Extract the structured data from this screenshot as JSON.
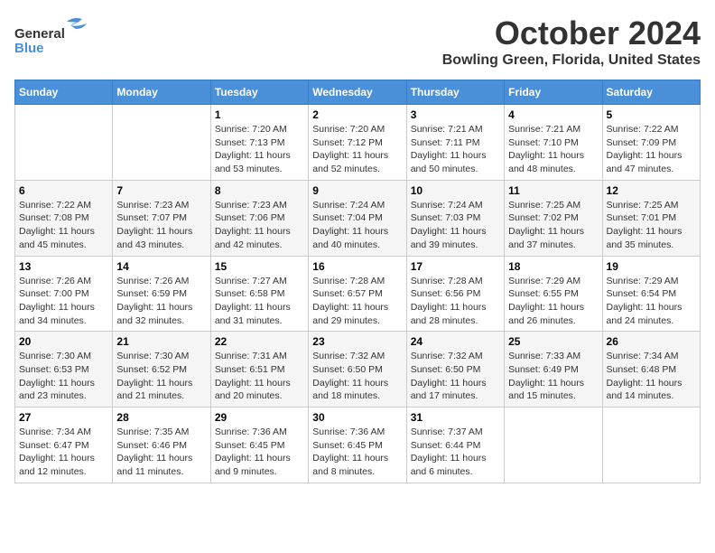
{
  "logo": {
    "text1": "General",
    "text2": "Blue"
  },
  "title": "October 2024",
  "location": "Bowling Green, Florida, United States",
  "weekdays": [
    "Sunday",
    "Monday",
    "Tuesday",
    "Wednesday",
    "Thursday",
    "Friday",
    "Saturday"
  ],
  "weeks": [
    [
      {
        "day": "",
        "sunrise": "",
        "sunset": "",
        "daylight": ""
      },
      {
        "day": "",
        "sunrise": "",
        "sunset": "",
        "daylight": ""
      },
      {
        "day": "1",
        "sunrise": "Sunrise: 7:20 AM",
        "sunset": "Sunset: 7:13 PM",
        "daylight": "Daylight: 11 hours and 53 minutes."
      },
      {
        "day": "2",
        "sunrise": "Sunrise: 7:20 AM",
        "sunset": "Sunset: 7:12 PM",
        "daylight": "Daylight: 11 hours and 52 minutes."
      },
      {
        "day": "3",
        "sunrise": "Sunrise: 7:21 AM",
        "sunset": "Sunset: 7:11 PM",
        "daylight": "Daylight: 11 hours and 50 minutes."
      },
      {
        "day": "4",
        "sunrise": "Sunrise: 7:21 AM",
        "sunset": "Sunset: 7:10 PM",
        "daylight": "Daylight: 11 hours and 48 minutes."
      },
      {
        "day": "5",
        "sunrise": "Sunrise: 7:22 AM",
        "sunset": "Sunset: 7:09 PM",
        "daylight": "Daylight: 11 hours and 47 minutes."
      }
    ],
    [
      {
        "day": "6",
        "sunrise": "Sunrise: 7:22 AM",
        "sunset": "Sunset: 7:08 PM",
        "daylight": "Daylight: 11 hours and 45 minutes."
      },
      {
        "day": "7",
        "sunrise": "Sunrise: 7:23 AM",
        "sunset": "Sunset: 7:07 PM",
        "daylight": "Daylight: 11 hours and 43 minutes."
      },
      {
        "day": "8",
        "sunrise": "Sunrise: 7:23 AM",
        "sunset": "Sunset: 7:06 PM",
        "daylight": "Daylight: 11 hours and 42 minutes."
      },
      {
        "day": "9",
        "sunrise": "Sunrise: 7:24 AM",
        "sunset": "Sunset: 7:04 PM",
        "daylight": "Daylight: 11 hours and 40 minutes."
      },
      {
        "day": "10",
        "sunrise": "Sunrise: 7:24 AM",
        "sunset": "Sunset: 7:03 PM",
        "daylight": "Daylight: 11 hours and 39 minutes."
      },
      {
        "day": "11",
        "sunrise": "Sunrise: 7:25 AM",
        "sunset": "Sunset: 7:02 PM",
        "daylight": "Daylight: 11 hours and 37 minutes."
      },
      {
        "day": "12",
        "sunrise": "Sunrise: 7:25 AM",
        "sunset": "Sunset: 7:01 PM",
        "daylight": "Daylight: 11 hours and 35 minutes."
      }
    ],
    [
      {
        "day": "13",
        "sunrise": "Sunrise: 7:26 AM",
        "sunset": "Sunset: 7:00 PM",
        "daylight": "Daylight: 11 hours and 34 minutes."
      },
      {
        "day": "14",
        "sunrise": "Sunrise: 7:26 AM",
        "sunset": "Sunset: 6:59 PM",
        "daylight": "Daylight: 11 hours and 32 minutes."
      },
      {
        "day": "15",
        "sunrise": "Sunrise: 7:27 AM",
        "sunset": "Sunset: 6:58 PM",
        "daylight": "Daylight: 11 hours and 31 minutes."
      },
      {
        "day": "16",
        "sunrise": "Sunrise: 7:28 AM",
        "sunset": "Sunset: 6:57 PM",
        "daylight": "Daylight: 11 hours and 29 minutes."
      },
      {
        "day": "17",
        "sunrise": "Sunrise: 7:28 AM",
        "sunset": "Sunset: 6:56 PM",
        "daylight": "Daylight: 11 hours and 28 minutes."
      },
      {
        "day": "18",
        "sunrise": "Sunrise: 7:29 AM",
        "sunset": "Sunset: 6:55 PM",
        "daylight": "Daylight: 11 hours and 26 minutes."
      },
      {
        "day": "19",
        "sunrise": "Sunrise: 7:29 AM",
        "sunset": "Sunset: 6:54 PM",
        "daylight": "Daylight: 11 hours and 24 minutes."
      }
    ],
    [
      {
        "day": "20",
        "sunrise": "Sunrise: 7:30 AM",
        "sunset": "Sunset: 6:53 PM",
        "daylight": "Daylight: 11 hours and 23 minutes."
      },
      {
        "day": "21",
        "sunrise": "Sunrise: 7:30 AM",
        "sunset": "Sunset: 6:52 PM",
        "daylight": "Daylight: 11 hours and 21 minutes."
      },
      {
        "day": "22",
        "sunrise": "Sunrise: 7:31 AM",
        "sunset": "Sunset: 6:51 PM",
        "daylight": "Daylight: 11 hours and 20 minutes."
      },
      {
        "day": "23",
        "sunrise": "Sunrise: 7:32 AM",
        "sunset": "Sunset: 6:50 PM",
        "daylight": "Daylight: 11 hours and 18 minutes."
      },
      {
        "day": "24",
        "sunrise": "Sunrise: 7:32 AM",
        "sunset": "Sunset: 6:50 PM",
        "daylight": "Daylight: 11 hours and 17 minutes."
      },
      {
        "day": "25",
        "sunrise": "Sunrise: 7:33 AM",
        "sunset": "Sunset: 6:49 PM",
        "daylight": "Daylight: 11 hours and 15 minutes."
      },
      {
        "day": "26",
        "sunrise": "Sunrise: 7:34 AM",
        "sunset": "Sunset: 6:48 PM",
        "daylight": "Daylight: 11 hours and 14 minutes."
      }
    ],
    [
      {
        "day": "27",
        "sunrise": "Sunrise: 7:34 AM",
        "sunset": "Sunset: 6:47 PM",
        "daylight": "Daylight: 11 hours and 12 minutes."
      },
      {
        "day": "28",
        "sunrise": "Sunrise: 7:35 AM",
        "sunset": "Sunset: 6:46 PM",
        "daylight": "Daylight: 11 hours and 11 minutes."
      },
      {
        "day": "29",
        "sunrise": "Sunrise: 7:36 AM",
        "sunset": "Sunset: 6:45 PM",
        "daylight": "Daylight: 11 hours and 9 minutes."
      },
      {
        "day": "30",
        "sunrise": "Sunrise: 7:36 AM",
        "sunset": "Sunset: 6:45 PM",
        "daylight": "Daylight: 11 hours and 8 minutes."
      },
      {
        "day": "31",
        "sunrise": "Sunrise: 7:37 AM",
        "sunset": "Sunset: 6:44 PM",
        "daylight": "Daylight: 11 hours and 6 minutes."
      },
      {
        "day": "",
        "sunrise": "",
        "sunset": "",
        "daylight": ""
      },
      {
        "day": "",
        "sunrise": "",
        "sunset": "",
        "daylight": ""
      }
    ]
  ]
}
